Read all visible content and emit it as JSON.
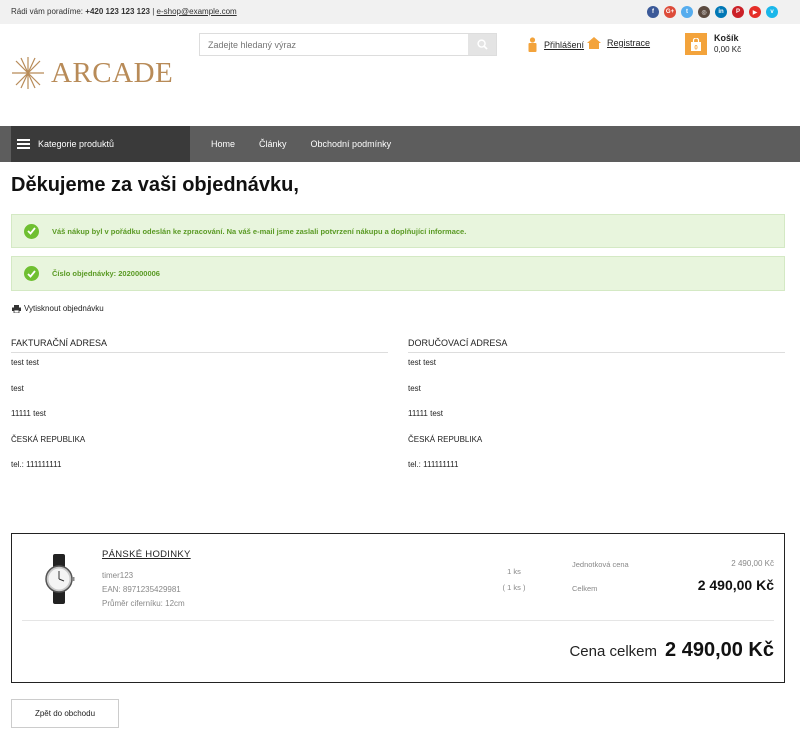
{
  "topbar": {
    "advise_text": "Rádi vám poradíme:",
    "phone": "+420 123 123 123",
    "separator": "|",
    "email": "e-shop@example.com",
    "socials": [
      {
        "name": "facebook-icon",
        "glyph": "f",
        "color": "#3b5998"
      },
      {
        "name": "google-plus-icon",
        "glyph": "G+",
        "color": "#dd4b39"
      },
      {
        "name": "twitter-icon",
        "glyph": "t",
        "color": "#55acee"
      },
      {
        "name": "instagram-icon",
        "glyph": "◎",
        "color": "#5b4a3f"
      },
      {
        "name": "linkedin-icon",
        "glyph": "in",
        "color": "#0077b5"
      },
      {
        "name": "pinterest-icon",
        "glyph": "P",
        "color": "#cb2027"
      },
      {
        "name": "youtube-icon",
        "glyph": "▶",
        "color": "#e52d27"
      },
      {
        "name": "vimeo-icon",
        "glyph": "v",
        "color": "#1ab7ea"
      }
    ]
  },
  "header": {
    "logo_text": "ARCADE",
    "search_placeholder": "Zadejte hledaný výraz",
    "login": "Přihlášení",
    "register": "Registrace",
    "cart_label": "Košík",
    "cart_total": "0,00 Kč"
  },
  "nav": {
    "categories": "Kategorie produktů",
    "links": [
      "Home",
      "Články",
      "Obchodní podmínky"
    ]
  },
  "page": {
    "title": "Děkujeme za vaši objednávku,",
    "alert_message": "Váš nákup byl v pořádku odeslán ke zpracování. Na váš e-mail jsme zaslali potvrzení nákupu a doplňující informace.",
    "order_number": "Číslo objednávky: 2020000006",
    "print_label": "Vytisknout objednávku"
  },
  "billing": {
    "heading": "FAKTURAČNÍ ADRESA",
    "lines": [
      "test test",
      "test",
      "11111 test",
      "ČESKÁ REPUBLIKA",
      "tel.: 111111111"
    ]
  },
  "shipping": {
    "heading": "DORUČOVACÍ ADRESA",
    "lines": [
      "test test",
      "test",
      "11111 test",
      "ČESKÁ REPUBLIKA",
      "tel.: 111111111"
    ]
  },
  "order": {
    "product_name": "PÁNSKÉ HODINKY",
    "sku": "timer123",
    "ean": "EAN: 8971235429981",
    "dial": "Průměr ciferníku: 12cm",
    "qty": "1 ks",
    "qty_sub": "( 1 ks )",
    "unit_price_label": "Jednotková cena",
    "unit_price": "2 490,00 Kč",
    "total_label": "Celkem",
    "total": "2 490,00 Kč",
    "grand_total_label": "Cena celkem",
    "grand_total": "2 490,00 Kč"
  },
  "back_button": "Zpět do obchodu"
}
